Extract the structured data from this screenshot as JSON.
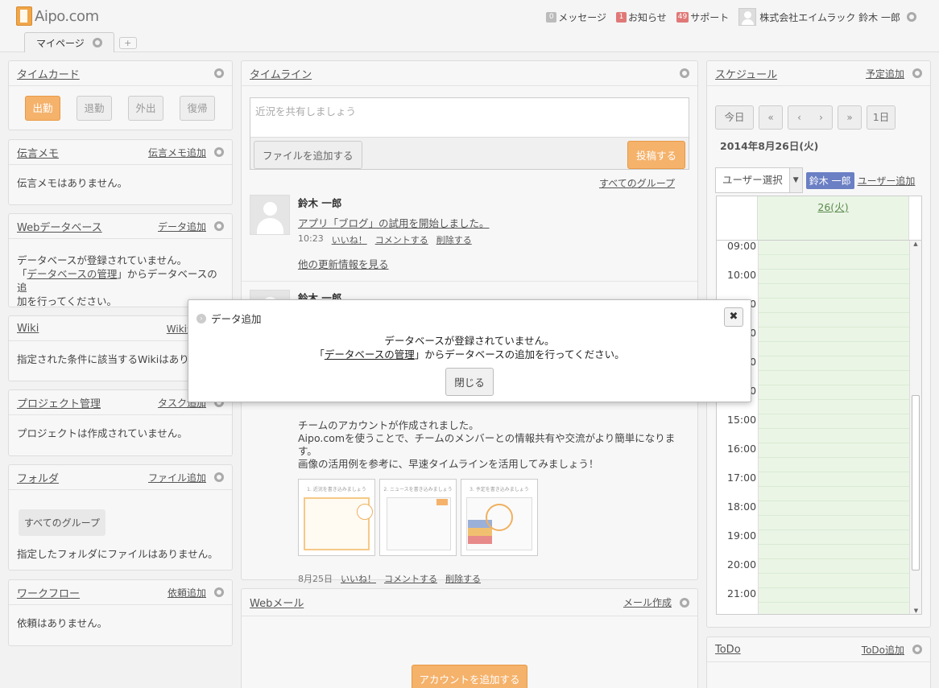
{
  "header": {
    "logo_text": "Aipo.com",
    "messages_count": "0",
    "messages_label": "メッセージ",
    "notice_count": "1",
    "notice_label": "お知らせ",
    "support_count": "49",
    "support_label": "サポート",
    "user_name": "株式会社エイムラック 鈴木 一郎"
  },
  "tabs": {
    "mypage": "マイページ",
    "add": "+"
  },
  "timecard": {
    "title": "タイムカード",
    "buttons": [
      "出勤",
      "退勤",
      "外出",
      "復帰"
    ]
  },
  "memo": {
    "title": "伝言メモ",
    "action": "伝言メモ追加",
    "empty": "伝言メモはありません。"
  },
  "webdb": {
    "title": "Webデータベース",
    "action": "データ追加",
    "line1": "データベースが登録されていません。",
    "line2_pre": "「",
    "line2_link": "データベースの管理",
    "line2_post": "」からデータベースの追",
    "line3": "加を行ってください。"
  },
  "wiki": {
    "title": "Wiki",
    "action": "Wiki追加",
    "empty": "指定された条件に該当するWikiはありません。"
  },
  "project": {
    "title": "プロジェクト管理",
    "action": "タスク追加",
    "empty": "プロジェクトは作成されていません。"
  },
  "folder": {
    "title": "フォルダ",
    "action": "ファイル追加",
    "group_button": "すべてのグループ",
    "empty": "指定したフォルダにファイルはありません。"
  },
  "workflow": {
    "title": "ワークフロー",
    "action": "依頼追加",
    "empty": "依頼はありません。"
  },
  "timeline": {
    "title": "タイムライン",
    "placeholder": "近況を共有しましょう",
    "add_file": "ファイルを追加する",
    "post": "投稿する",
    "group_filter": "すべてのグループ",
    "posts": [
      {
        "author": "鈴木 一郎",
        "body": "アプリ「ブログ」の試用を開始しました。",
        "time": "10:23",
        "like": "いいね！",
        "comment": "コメントする",
        "delete": "削除する",
        "more": "他の更新情報を見る"
      },
      {
        "author": "鈴木 一郎",
        "line1": "チームのアカウントが作成されました。",
        "line2": "Aipo.comを使うことで、チームのメンバーとの情報共有や交流がより簡単になります。",
        "line3": "画像の活用例を参考に、早速タイムラインを活用してみましょう！",
        "thumbs": [
          "1. 近況を書き込みましょう",
          "2. ニュースを書き込みましょう",
          "3. 予定を書き込みましょう"
        ],
        "time": "8月25日",
        "like": "いいね！",
        "comment": "コメントする",
        "delete": "削除する"
      }
    ]
  },
  "webmail": {
    "title": "Webメール",
    "action": "メール作成",
    "add_account": "アカウントを追加する"
  },
  "schedule": {
    "title": "スケジュール",
    "action": "予定追加",
    "today": "今日",
    "day1": "1日",
    "date": "2014年8月26日(火)",
    "user_select": "ユーザー選択",
    "user_chip": "鈴木 一郎",
    "user_add": "ユーザー追加",
    "day_header": "26(火)",
    "times": [
      "09:00",
      "10:00",
      "11:00",
      "12:00",
      "13:00",
      "14:00",
      "15:00",
      "16:00",
      "17:00",
      "18:00",
      "19:00",
      "20:00",
      "21:00"
    ]
  },
  "todo": {
    "title": "ToDo",
    "action": "ToDo追加"
  },
  "modal": {
    "title": "データ追加",
    "line1": "データベースが登録されていません。",
    "line2_pre": "「",
    "line2_link": "データベースの管理",
    "line2_post": "」からデータベースの追加を行ってください。",
    "close": "閉じる"
  }
}
